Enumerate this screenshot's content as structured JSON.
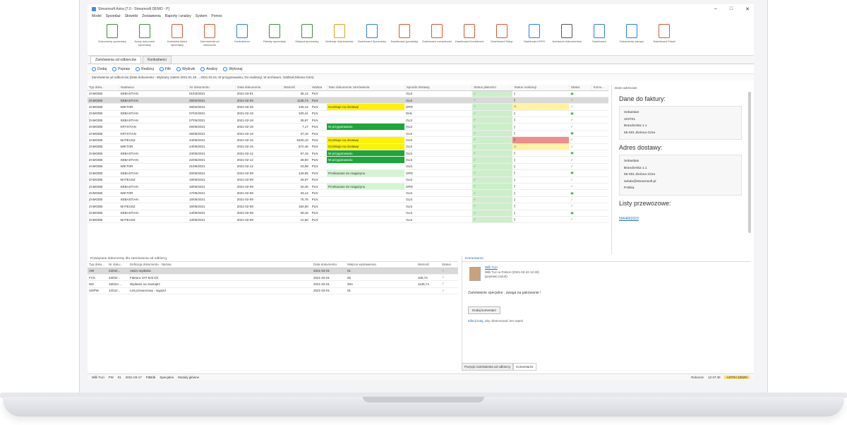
{
  "window": {
    "title": "Streamsoft Astra [7.0 - Streamsoft DEMO - P]"
  },
  "menu": [
    "Model",
    "Sprzedaż",
    "Słowniki",
    "Zestawienia",
    "Raporty i analizy",
    "System",
    "Pomoc"
  ],
  "ribbon": [
    {
      "label": "Dokumenty sprzedaży",
      "color": "#3c8d3c"
    },
    {
      "label": "Nowy dokument sprzedaży",
      "color": "#3c8d3c"
    },
    {
      "label": "Kartoteka faktur sprzedaży",
      "color": "#d15b2e"
    },
    {
      "label": "Zamówienia od odbiorców",
      "color": "#d15b2e"
    },
    {
      "label": "Kontrahenci",
      "color": "#2b7fd6"
    },
    {
      "label": "Rabaty sprzedaży",
      "color": "#3c8d3c"
    },
    {
      "label": "Miejsca sprzedaży",
      "color": "#3c8d3c"
    },
    {
      "label": "Definicje dokumentów",
      "color": "#e0a020"
    },
    {
      "label": "Dashboard Sprzedaży",
      "color": "#2b7fd6"
    },
    {
      "label": "Dashboard (produkty)",
      "color": "#d15b2e"
    },
    {
      "label": "Dashboard rozrachunki",
      "color": "#d15b2e"
    },
    {
      "label": "Dashboard Kontrahent",
      "color": "#d15b2e"
    },
    {
      "label": "Dashboard Setup",
      "color": "#d15b2e"
    },
    {
      "label": "Dashboard KPIS",
      "color": "#2b7fd6"
    },
    {
      "label": "Archiwum dokumentów",
      "color": "#555555"
    },
    {
      "label": "Dashboard",
      "color": "#2b7fd6"
    },
    {
      "label": "Dokumenty zakupu",
      "color": "#2b7fd6"
    },
    {
      "label": "Dashboard Fiskal",
      "color": "#d15b2e"
    }
  ],
  "tabs": [
    "Zamówienia od odbiorców",
    "Kontrahenci"
  ],
  "toolbar": [
    "Dodaj",
    "Popraw",
    "Realizuj",
    "Filtr",
    "Wydruki",
    "Analizy",
    "Wykonaj"
  ],
  "filter_text": "Zamówienia od odbiorców (Data dokumentu - Wybrany zakres 2021.01.18 ... 2021.03.24, W przygotowaniu, Do realizacji, W archiwum, Oddział Zielona Góra)",
  "grid": {
    "headers": [
      "Typ doku...",
      "Nadawca",
      "Nr dokumentu",
      "Data dokumentu",
      "Wartość",
      "Waluta",
      "Stan dokumentu zamówienia",
      "Sposób dostawy",
      "Status płatności",
      "Status realizacji",
      "Status",
      "Komu..."
    ],
    "rows": [
      {
        "type": "ZAMODB",
        "sender": "SEBASTIAN",
        "nr": "01/03/2021",
        "date": "2021-03-01",
        "value": "35,12",
        "cur": "PLN",
        "state": "",
        "state_cls": "",
        "del": "GLS",
        "pay": "green",
        "ship": "",
        "selected": false
      },
      {
        "type": "ZAMODB",
        "sender": "SEBASTIAN",
        "nr": "25/02/2021",
        "date": "2021-02-25",
        "value": "1135,74",
        "cur": "PLN",
        "state": "",
        "state_cls": "",
        "del": "GLS",
        "pay": "green",
        "ship": "",
        "selected": true
      },
      {
        "type": "ZAMODB",
        "sender": "WIKTOR",
        "nr": "26/02/2021",
        "date": "2021-02-25",
        "value": "125,12",
        "cur": "PLN",
        "state": "Oczekuje na dostawę",
        "state_cls": "st-y",
        "del": "DPD",
        "pay": "green",
        "ship": "yellow",
        "selected": false
      },
      {
        "type": "ZAMODB",
        "sender": "SEBASTIAN",
        "nr": "07/02/2021",
        "date": "2021-02-18",
        "value": "100,41",
        "cur": "PLN",
        "state": "",
        "state_cls": "",
        "del": "DHL",
        "pay": "green",
        "ship": "",
        "selected": false
      },
      {
        "type": "ZAMODB",
        "sender": "SEBASTIAN",
        "nr": "07/05/2021",
        "date": "2021-02-18",
        "value": "35,97",
        "cur": "PLN",
        "state": "",
        "state_cls": "",
        "del": "GLS",
        "pay": "green",
        "ship": "",
        "selected": false
      },
      {
        "type": "ZAMODB",
        "sender": "KRYSTIAN",
        "nr": "26/05/2021",
        "date": "2021-02-18",
        "value": "7,17",
        "cur": "PLN",
        "state": "W przygotowaniu",
        "state_cls": "st-g",
        "del": "GLS",
        "pay": "green",
        "ship": "",
        "selected": false
      },
      {
        "type": "ZAMODB",
        "sender": "KRYSTIAN",
        "nr": "26/05/2021",
        "date": "2021-02-18",
        "value": "37,15",
        "cur": "PLN",
        "state": "",
        "state_cls": "",
        "del": "GLS",
        "pay": "green",
        "ship": "",
        "selected": false
      },
      {
        "type": "ZAMODB",
        "sender": "MATEUSZ",
        "nr": "24/05/2021",
        "date": "2021-02-16",
        "value": "5400,10",
        "cur": "PLN",
        "state": "Oczekuje na dostawę",
        "state_cls": "st-y",
        "del": "GLS",
        "pay": "green",
        "ship": "red",
        "selected": false
      },
      {
        "type": "ZAMODB",
        "sender": "WIKTOR",
        "nr": "24/05/2021",
        "date": "2021-02-16",
        "value": "572,46",
        "cur": "PLN",
        "state": "Oczekuje na dostawę",
        "state_cls": "st-y",
        "del": "GLS",
        "pay": "green",
        "ship": "yellow",
        "selected": false
      },
      {
        "type": "ZAMODB",
        "sender": "SEBASTIAN",
        "nr": "23/05/2021",
        "date": "2021-02-12",
        "value": "97,15",
        "cur": "PLN",
        "state": "W przygotowaniu",
        "state_cls": "st-g",
        "del": "GLS",
        "pay": "green",
        "ship": "",
        "selected": false
      },
      {
        "type": "ZAMODB",
        "sender": "SEBASTIAN",
        "nr": "22/05/2021",
        "date": "2021-02-12",
        "value": "28,50",
        "cur": "PLN",
        "state": "W przygotowaniu",
        "state_cls": "st-g",
        "del": "GLS",
        "pay": "green",
        "ship": "",
        "selected": false
      },
      {
        "type": "ZAMODB",
        "sender": "WIKTOR",
        "nr": "21/05/2021",
        "date": "2021-02-12",
        "value": "23,58",
        "cur": "PLN",
        "state": "",
        "state_cls": "",
        "del": "GLS",
        "pay": "green",
        "ship": "",
        "selected": false
      },
      {
        "type": "ZAMODB",
        "sender": "SEBASTIAN",
        "nr": "20/05/2021",
        "date": "2021-02-09",
        "value": "129,95",
        "cur": "PLN",
        "state": "Przekazane do magazynu",
        "state_cls": "st-lg",
        "del": "DPD",
        "pay": "green",
        "ship": "",
        "selected": false
      },
      {
        "type": "ZAMODB",
        "sender": "MATEUSZ",
        "nr": "19/05/2021",
        "date": "2021-02-09",
        "value": "28,97",
        "cur": "PLN",
        "state": "",
        "state_cls": "",
        "del": "GLS",
        "pay": "green",
        "ship": "",
        "selected": false
      },
      {
        "type": "ZAMODB",
        "sender": "SEBASTIAN",
        "nr": "18/05/2021",
        "date": "2021-02-09",
        "value": "25,45",
        "cur": "PLN",
        "state": "Przekazane do magazynu",
        "state_cls": "st-lg",
        "del": "DPD",
        "pay": "green",
        "ship": "",
        "selected": false
      },
      {
        "type": "ZAMODB",
        "sender": "WIKTOR",
        "nr": "17/05/2021",
        "date": "2021-02-09",
        "value": "33,14",
        "cur": "PLN",
        "state": "",
        "state_cls": "",
        "del": "GLS",
        "pay": "green",
        "ship": "",
        "selected": false
      },
      {
        "type": "ZAMODB",
        "sender": "SEBASTIAN",
        "nr": "16/05/2021",
        "date": "2021-02-09",
        "value": "75,75",
        "cur": "PLN",
        "state": "",
        "state_cls": "",
        "del": "GLS",
        "pay": "green",
        "ship": "",
        "selected": false
      },
      {
        "type": "ZAMODB",
        "sender": "MATEUSZ",
        "nr": "15/05/2021",
        "date": "2021-02-08",
        "value": "150,50",
        "cur": "PLN",
        "state": "",
        "state_cls": "",
        "del": "GLS",
        "pay": "green",
        "ship": "",
        "selected": false
      },
      {
        "type": "ZAMODB",
        "sender": "SEBASTIAN",
        "nr": "14/05/2021",
        "date": "2021-02-08",
        "value": "30,15",
        "cur": "PLN",
        "state": "",
        "state_cls": "",
        "del": "GLS",
        "pay": "green",
        "ship": "",
        "selected": false
      },
      {
        "type": "ZAMODB",
        "sender": "MATEUSZ",
        "nr": "13/05/2021",
        "date": "2021-02-08",
        "value": "12,50",
        "cur": "PLN",
        "state": "",
        "state_cls": "",
        "del": "GLS",
        "pay": "green",
        "ship": "",
        "selected": false
      }
    ]
  },
  "side": {
    "header": "Dane adresowe",
    "billing_title": "Dane do faktury:",
    "billing": [
      "Sebastian",
      "103701",
      "Brandorska 1.1",
      "65-001 Zielona Góra"
    ],
    "delivery_title": "Adres dostawy:",
    "delivery": [
      "Sebastian",
      "Brandorska 1.1",
      "65-001 Zielona Góra",
      "sebdo@streamsoft.pl",
      "Polska"
    ],
    "waybills_title": "Listy przewozowe:",
    "waybill": "5664663323"
  },
  "lower": {
    "header": "Powiązane dokumenty dla zamówienia od odbiorcy",
    "headers": [
      "Typ doku...",
      "Nr doku...",
      "Definicja dokumentu - Nazwa",
      "Data dokumentu",
      "Miejsce wystawienia",
      "Wartość",
      "Status"
    ],
    "rows": [
      {
        "type": "AW",
        "nr": "23/02/...",
        "def": "Awizo wydania",
        "date": "2021-02-01",
        "place": "01",
        "value": "",
        "selected": true
      },
      {
        "type": "FVS",
        "nr": "23/02/...",
        "def": "Faktura VAT krót k/2",
        "date": "2021-02-01",
        "place": "06",
        "value": "105,74",
        "selected": false
      },
      {
        "type": "WZ",
        "nr": "16/02A...",
        "def": "Wydanie na zewnątrz",
        "date": "2021-02-01",
        "place": "00A",
        "value": "1135,74",
        "selected": false
      },
      {
        "type": "UNPW",
        "nr": "14/12/...",
        "def": "List przewozowy - wyjazd",
        "date": "2021-02-01",
        "place": "01",
        "value": "",
        "selected": false
      }
    ]
  },
  "comments": {
    "header": "Komentarze",
    "author": "Willi Tuzi",
    "line1": "Willi Tuzi w Polsce",
    "time": "(2021-02-22 12:40)",
    "edit": "(popraw) (usuń)",
    "text": "Zamówienie specjalne , uwaga na pakowanie !",
    "button": "Dodaj komentarz",
    "footer_link": "Kliknij tutaj",
    "footer_text": ", aby obserwować ten wątek"
  },
  "bottom_tabs": [
    "Pozycje zamówienia od odbiorcy",
    "Komentarze"
  ],
  "status": {
    "items": [
      "Willi Tuzi",
      "FW",
      "01",
      "2021-03-17",
      "PdBdb",
      "Specjalne",
      "Moduły główne"
    ],
    "right": [
      "Robocze",
      "12:47:40"
    ],
    "badge": "ASTRA DEMO"
  }
}
